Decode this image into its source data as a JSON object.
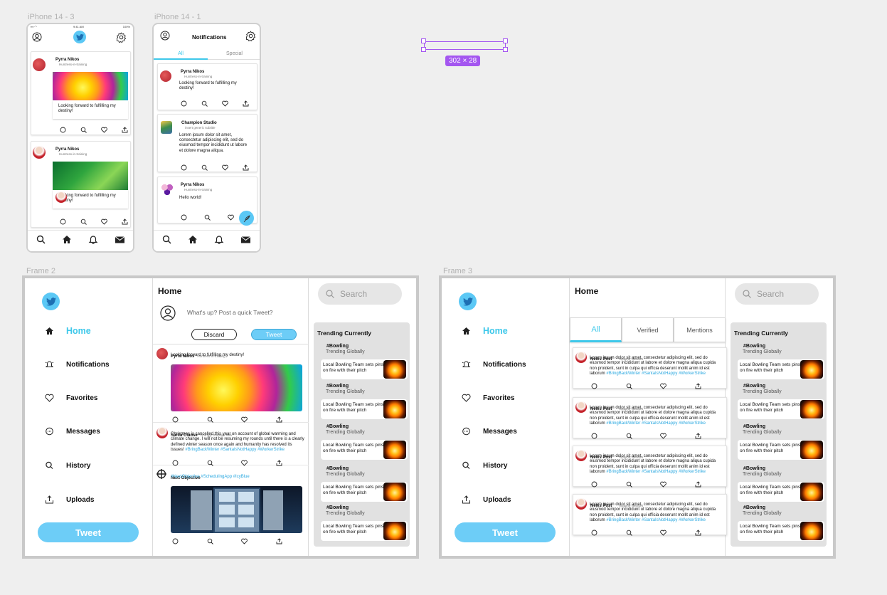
{
  "frames": {
    "phone1": "iPhone 14 - 3",
    "phone2": "iPhone 14 - 1",
    "desk1": "Frame 2",
    "desk2": "Frame 3"
  },
  "selection": {
    "size_label": "302 × 28",
    "color": "#a456f0"
  },
  "colors": {
    "accent": "#3ec8ea",
    "tweet_button": "#6dcdf7",
    "hashtag": "#2aa8e0"
  },
  "phone1": {
    "status": {
      "time": "9:41 AM",
      "battery": "100%"
    },
    "posts": [
      {
        "name": "Pyrra Nikos",
        "sub": "Huntress-in-training",
        "text": "Looking forward to fulfilling my destiny!"
      },
      {
        "name": "Pyrra Nikos",
        "sub": "Huntress-in-training",
        "text": "Looking forward to fulfilling my destiny!"
      }
    ]
  },
  "phone2": {
    "title": "Notifications",
    "tabs": [
      "All",
      "Special"
    ],
    "posts": [
      {
        "name": "Pyrra Nikos",
        "sub": "Huntress-in-training",
        "text": "Looking forward to fulfilling my destiny!"
      },
      {
        "name": "Champion Studio",
        "sub": "insert generic subtitle",
        "text": "Lorem ipsum dolor sit amet, consectetur adipiscing elit, sed do eiusmod tempor incididunt ut labore et dolore magna aliqua."
      },
      {
        "name": "Pyrra Nikos",
        "sub": "Huntress-in-training",
        "text": "Hello world!"
      }
    ]
  },
  "nav": {
    "items": [
      "Home",
      "Notifications",
      "Favorites",
      "Messages",
      "History",
      "Uploads"
    ],
    "tweet": "Tweet"
  },
  "desk1": {
    "title": "Home",
    "compose_placeholder": "What's up? Post a quick Tweet?",
    "discard": "Discard",
    "tweet": "Tweet",
    "posts": [
      {
        "name": "Pyrra Nikos",
        "sub": "Huntress-in-training",
        "text": "Looking forward to fulfilling my destiny!"
      },
      {
        "name": "Santa Clause",
        "sub": "Grumpy Grandpa Nick",
        "text": "Christmas is cancelled this year on account of global warming and climate change. I will not be resuming my rounds until there is a clearly defined winter season once again and humanity has resolved its issues!",
        "tags": "#BringBackWinter #SantaIsNotHappy #WorkerStrike"
      },
      {
        "name": "Next Objective",
        "sub": "",
        "text": "",
        "tags": "#NextObjective #SchedulingApp #IcyBlue"
      }
    ]
  },
  "desk2": {
    "title": "Home",
    "tabs": [
      "All",
      "Verified",
      "Mentions"
    ],
    "post": {
      "name": "News Post",
      "sub": "Imagine Network",
      "text": "Lorem ipsum dolor sit amet, consectetur adipiscing elit, sed do eiusmod tempor incididunt ut labore et dolore magna aliqua cupida non proident, sunt in culpa qui officia deserunt mollit anim id est laborum",
      "tags": "#BringBackWinter #SantaIsNotHappy #WorkerStrike"
    }
  },
  "search_placeholder": "Search",
  "trending": {
    "title": "Trending Currently",
    "items": [
      {
        "tag": "#Bowling",
        "scope": "Trending Globally",
        "headline": "Local Bowling Team sets pins on fire with their pitch"
      },
      {
        "tag": "#Bowling",
        "scope": "Trending Globally",
        "headline": "Local Bowling Team sets pins on fire with their pitch"
      },
      {
        "tag": "#Bowling",
        "scope": "Trending Globally",
        "headline": "Local Bowling Team sets pins on fire with their pitch"
      },
      {
        "tag": "#Bowling",
        "scope": "Trending Globally",
        "headline": "Local Bowling Team sets pins on fire with their pitch"
      },
      {
        "tag": "#Bowling",
        "scope": "Trending Globally",
        "headline": "Local Bowling Team sets pins on fire with their pitch"
      }
    ]
  }
}
